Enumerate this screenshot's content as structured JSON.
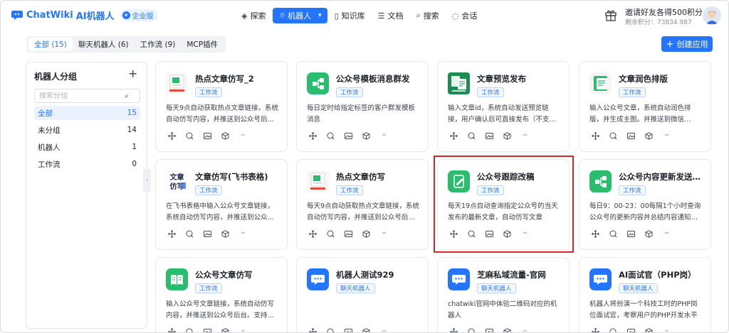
{
  "header": {
    "logo_text": "ChatWiki",
    "logo_suffix": "AI机器人",
    "edition_badge": "企业版",
    "nav": [
      {
        "label": "探索",
        "icon": "explore-icon",
        "active": false
      },
      {
        "label": "机器人",
        "icon": "robot-icon",
        "active": true
      },
      {
        "label": "知识库",
        "icon": "book-icon",
        "active": false
      },
      {
        "label": "文档",
        "icon": "document-icon",
        "active": false
      },
      {
        "label": "搜索",
        "icon": "search-icon",
        "active": false
      },
      {
        "label": "会话",
        "icon": "chat-icon",
        "active": false
      }
    ],
    "invite_title": "邀请好友各得500积分",
    "invite_points": "剩余积分：73834.987"
  },
  "tabs": [
    {
      "label": "全部 (15)",
      "active": true
    },
    {
      "label": "聊天机器人 (6)",
      "active": false
    },
    {
      "label": "工作流 (9)",
      "active": false
    },
    {
      "label": "MCP插件",
      "active": false
    }
  ],
  "create_button": "创建应用",
  "sidebar": {
    "title": "机器人分组",
    "search_placeholder": "搜索分组",
    "groups": [
      {
        "label": "全部",
        "count": "15",
        "active": true
      },
      {
        "label": "未分组",
        "count": "14",
        "active": false
      },
      {
        "label": "机器人",
        "count": "1",
        "active": false
      },
      {
        "label": "工作流",
        "count": "0",
        "active": false
      }
    ]
  },
  "colors": {
    "accent": "#2475fc",
    "green": "#2bbd6e",
    "highlight": "#d9262b"
  },
  "cards": [
    {
      "title": "热点文章仿写_2",
      "tag": "工作流",
      "desc": "每天9点自动获取热点文章链接，系统自动仿写内容，并推送到公众号后…",
      "icon": "hot-article-thumb-icon"
    },
    {
      "title": "公众号模板消息群发",
      "tag": "工作流",
      "desc": "每日定时给指定标签的客户群发模板消息",
      "icon": "workflow-icon"
    },
    {
      "title": "文章预览发布",
      "tag": "工作流",
      "desc": "输入文章id，系统自动发送预览链接，用户确认后可直接发布（不支…",
      "icon": "article-preview-thumb-icon"
    },
    {
      "title": "文章润色排版",
      "tag": "工作流",
      "desc": "输入公众号文章，系统自动润色排版，并生成主图。并推送到微信…",
      "icon": "polish-doc-icon"
    },
    {
      "title": "文章仿写(飞书表格)",
      "tag": "工作流",
      "desc": "在飞书表格中输入公众号文章链接，系统自动仿写内容，并推送到公众…",
      "icon": "feishu-article-thumb-icon",
      "thumb_text": "文章仿写"
    },
    {
      "title": "热点文章仿写",
      "tag": "工作流",
      "desc": "每天9点自动获取热点文章链接，系统自动仿写内容，并推送到公众号后…",
      "icon": "hot-article-thumb-icon"
    },
    {
      "title": "公众号跟踪改稿",
      "tag": "工作流",
      "desc": "每天19点自动查询指定公众号的当天发布的最新文章，自动仿写文章",
      "icon": "edit-doc-icon"
    },
    {
      "title": "公众号内容更新发送…",
      "tag": "工作流",
      "desc": "每日9：00-23：00每隔1个小时查询公众号的更新内容并总结内容通知…",
      "icon": "workflow-icon"
    },
    {
      "title": "公众号文章仿写",
      "tag": "工作流",
      "desc": "输入公众号文章链接，系统自动仿写内容，并推送到公众号后台。支持…",
      "icon": "open-book-icon"
    },
    {
      "title": "机器人测试929",
      "tag": "聊天机器人",
      "desc": "",
      "icon": "chat-bubble-icon"
    },
    {
      "title": "芝麻私域流量-官网",
      "tag": "聊天机器人",
      "desc": "chatwiki官网中体验二维码对应的机器人",
      "icon": "chat-bubble-icon"
    },
    {
      "title": "AI面试官（PHP岗）",
      "tag": "聊天机器人",
      "desc": "机器人将扮演一个科技工时的PHP岗位面试官，考察用户的PHP开发水平",
      "icon": "chat-bubble-icon"
    }
  ],
  "card_actions": [
    "move-icon",
    "copy-icon",
    "image-icon",
    "package-icon",
    "more-icon"
  ],
  "more_label": "···"
}
